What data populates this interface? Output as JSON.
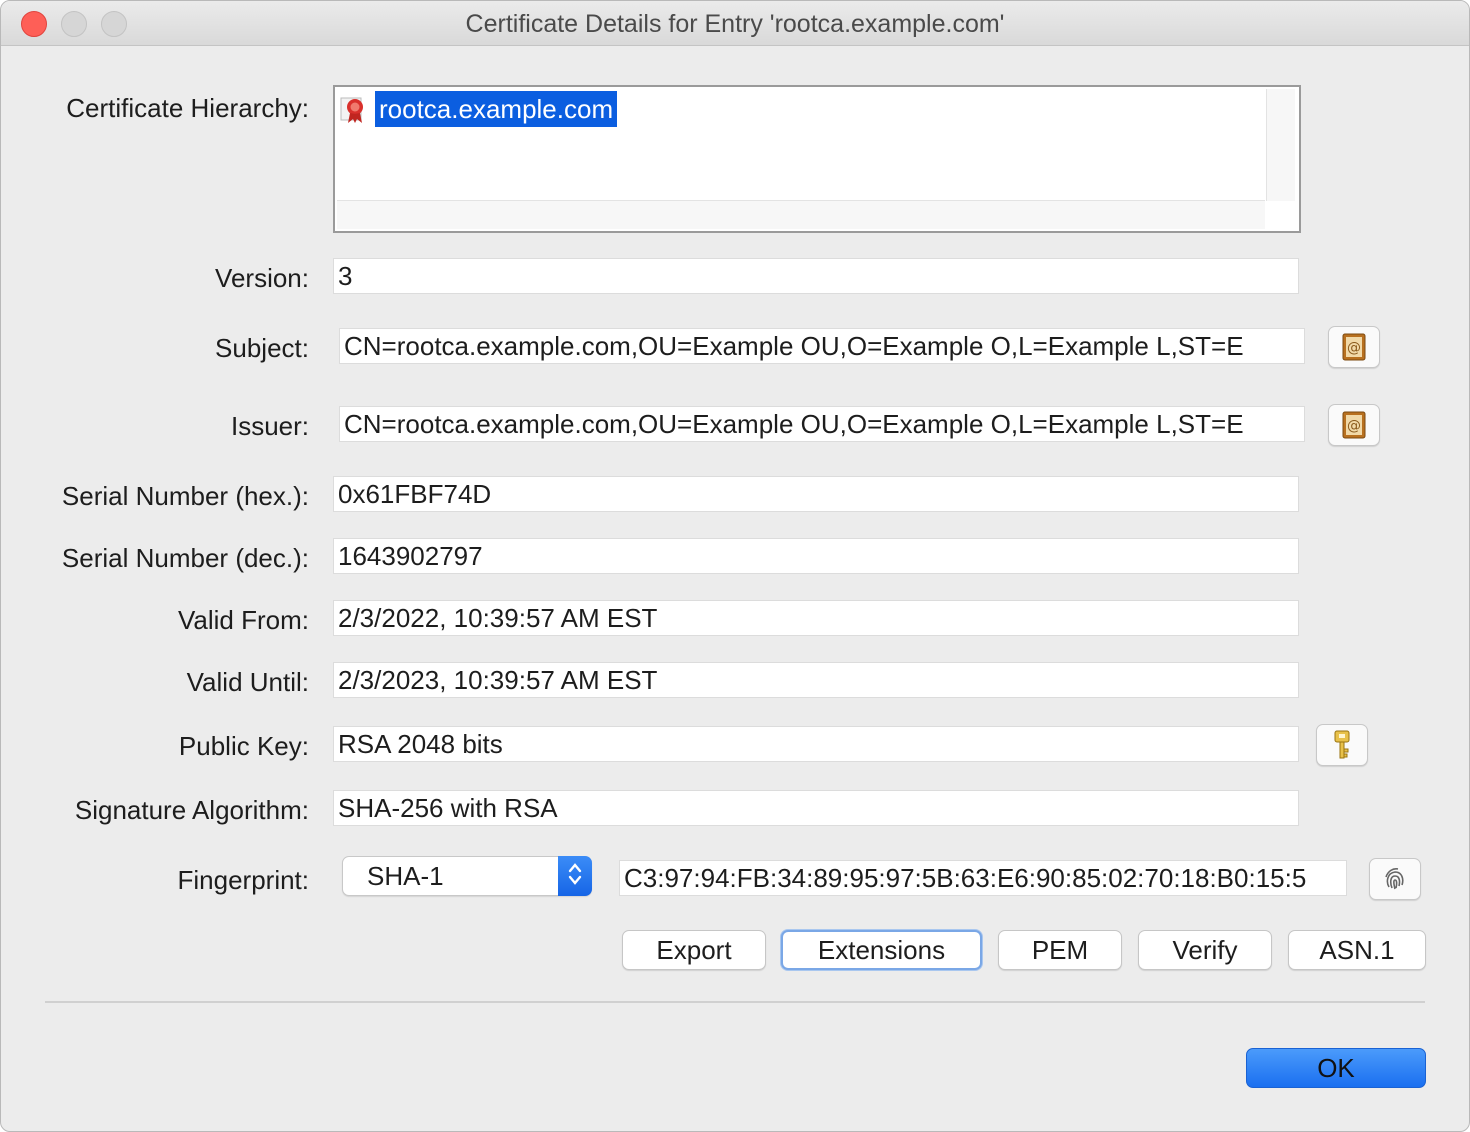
{
  "window": {
    "title": "Certificate Details for Entry 'rootca.example.com'"
  },
  "hierarchy": {
    "label": "Certificate Hierarchy:",
    "node": "rootca.example.com"
  },
  "fields": {
    "version": {
      "label": "Version:",
      "value": "3"
    },
    "subject": {
      "label": "Subject:",
      "value": "CN=rootca.example.com,OU=Example OU,O=Example O,L=Example L,ST=E"
    },
    "issuer": {
      "label": "Issuer:",
      "value": "CN=rootca.example.com,OU=Example OU,O=Example O,L=Example L,ST=E"
    },
    "serial_hex": {
      "label": "Serial Number (hex.):",
      "value": "0x61FBF74D"
    },
    "serial_dec": {
      "label": "Serial Number (dec.):",
      "value": "1643902797"
    },
    "valid_from": {
      "label": "Valid From:",
      "value": "2/3/2022, 10:39:57 AM EST"
    },
    "valid_until": {
      "label": "Valid Until:",
      "value": "2/3/2023, 10:39:57 AM EST"
    },
    "public_key": {
      "label": "Public Key:",
      "value": "RSA 2048 bits"
    },
    "signature_algorithm": {
      "label": "Signature Algorithm:",
      "value": "SHA-256 with RSA"
    },
    "fingerprint": {
      "label": "Fingerprint:",
      "algorithm": "SHA-1",
      "value": "C3:97:94:FB:34:89:95:97:5B:63:E6:90:85:02:70:18:B0:15:5"
    }
  },
  "buttons": {
    "export": "Export",
    "extensions": "Extensions",
    "pem": "PEM",
    "verify": "Verify",
    "asn1": "ASN.1",
    "ok": "OK"
  },
  "icons": {
    "cert": "certificate-icon",
    "subject_details": "address-book-icon",
    "issuer_details": "address-book-icon",
    "public_key": "key-icon",
    "fingerprint": "fingerprint-icon"
  },
  "colors": {
    "selection": "#0b5ee0",
    "ok_button": "#1a6ff0",
    "close_traffic_light": "#fe5f57"
  }
}
